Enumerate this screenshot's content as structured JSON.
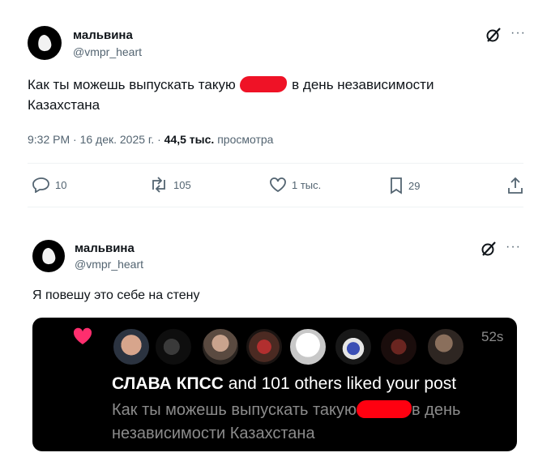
{
  "post1": {
    "author_name": "мальвина",
    "author_handle": "@vmpr_heart",
    "text_before": "Как ты можешь выпускать такую",
    "text_after": "в день независимости",
    "text_line2": "Казахстана",
    "time": "9:32 PM · 16 дек. 2025 г. · ",
    "views_count": "44,5 тыс.",
    "views_label": "просмотра",
    "actions": {
      "replies": "10",
      "reposts": "105",
      "likes": "1 тыс.",
      "bookmarks": "29"
    }
  },
  "post2": {
    "author_name": "мальвина",
    "author_handle": "@vmpr_heart",
    "text": "Я повешу это себе на стену"
  },
  "notification": {
    "liker_name": "СЛАВА КПСС",
    "rest_title": "and 101 others liked your post",
    "time": "52s",
    "body_before": "Как ты можешь выпускать такую",
    "body_after": "в день",
    "body_line2": "независимости Казахстана",
    "accent_color": "#ff2e6e"
  },
  "icons": [
    "grok-icon",
    "more-icon",
    "reply-icon",
    "repost-icon",
    "like-icon",
    "bookmark-icon",
    "share-icon",
    "heart-icon"
  ]
}
